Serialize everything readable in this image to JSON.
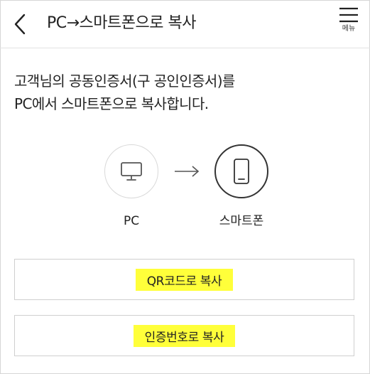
{
  "header": {
    "title": "PC→스마트폰으로 복사",
    "menu_label": "메뉴"
  },
  "description": {
    "line1": "고객님의 공동인증서(구 공인인증서)를",
    "line2": "PC에서 스마트폰으로 복사합니다."
  },
  "devices": {
    "source_label": "PC",
    "target_label": "스마트폰"
  },
  "actions": {
    "qr_label": "QR코드로 복사",
    "number_label": "인증번호로 복사"
  },
  "colors": {
    "highlight": "#ffff3a",
    "border": "#cfcfcf",
    "text": "#222222"
  },
  "icons": {
    "back": "chevron-left-icon",
    "menu": "hamburger-icon",
    "pc": "monitor-icon",
    "phone": "smartphone-icon",
    "arrow": "arrow-right-icon"
  }
}
